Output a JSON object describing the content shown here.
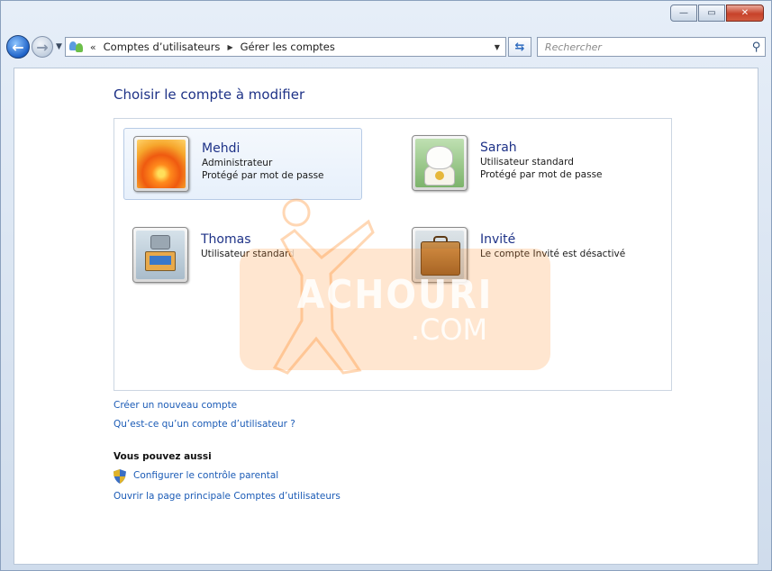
{
  "window": {
    "controls": {
      "minimize": "—",
      "maximize": "▭",
      "close": "✕"
    }
  },
  "navigation": {
    "breadcrumb_prefix": "«",
    "breadcrumbs": [
      "Comptes d’utilisateurs",
      "Gérer les comptes"
    ],
    "separator": "▶",
    "search_placeholder": "Rechercher"
  },
  "main": {
    "title": "Choisir le compte à modifier",
    "accounts": [
      {
        "name": "Mehdi",
        "type": "Administrateur",
        "status": "Protégé par mot de passe",
        "picture": "flower"
      },
      {
        "name": "Sarah",
        "type": "Utilisateur standard",
        "status": "Protégé par mot de passe",
        "picture": "lucky-cat"
      },
      {
        "name": "Thomas",
        "type": "Utilisateur standard",
        "status": "",
        "picture": "robot"
      },
      {
        "name": "Invité",
        "type": "Le compte Invité est désactivé",
        "status": "",
        "picture": "suitcase"
      }
    ],
    "links": {
      "create_account": "Créer un nouveau compte",
      "what_is_account": "Qu’est-ce qu’un compte d’utilisateur ?"
    },
    "also": {
      "heading": "Vous pouvez aussi",
      "parental_controls": "Configurer le contrôle parental",
      "open_main_page": "Ouvrir la page principale Comptes d’utilisateurs"
    }
  },
  "watermark": {
    "main": "ACHOURI",
    "sub": ".COM"
  },
  "colors": {
    "link": "#1b5bb6",
    "title": "#1e3287",
    "watermark": "#ff8c28"
  }
}
